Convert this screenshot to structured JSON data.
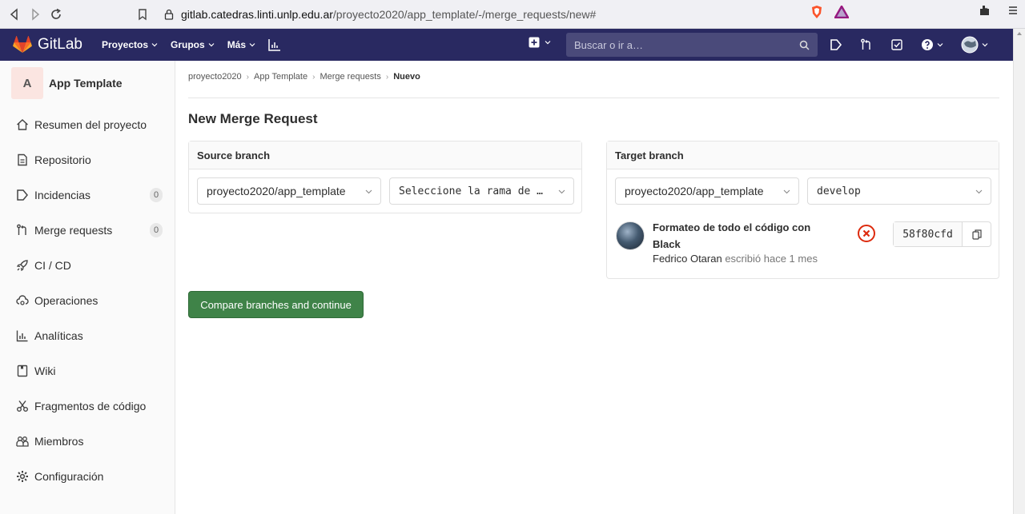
{
  "browser": {
    "url_host": "gitlab.catedras.linti.unlp.edu.ar",
    "url_path": "/proyecto2020/app_template/-/merge_requests/new#"
  },
  "navbar": {
    "brand": "GitLab",
    "menu": [
      "Proyectos",
      "Grupos",
      "Más"
    ],
    "search_placeholder": "Buscar o ir a…",
    "colors": {
      "bg": "#292961",
      "accent": "#fc6d26"
    }
  },
  "sidebar": {
    "project_avatar": "A",
    "project_name": "App Template",
    "items": [
      {
        "label": "Resumen del proyecto",
        "icon": "home-icon"
      },
      {
        "label": "Repositorio",
        "icon": "document-icon"
      },
      {
        "label": "Incidencias",
        "icon": "issues-icon",
        "badge": "0"
      },
      {
        "label": "Merge requests",
        "icon": "merge-request-icon",
        "badge": "0"
      },
      {
        "label": "CI / CD",
        "icon": "rocket-icon"
      },
      {
        "label": "Operaciones",
        "icon": "cloud-gear-icon"
      },
      {
        "label": "Analíticas",
        "icon": "chart-icon"
      },
      {
        "label": "Wiki",
        "icon": "book-icon"
      },
      {
        "label": "Fragmentos de código",
        "icon": "scissors-icon"
      },
      {
        "label": "Miembros",
        "icon": "users-icon"
      },
      {
        "label": "Configuración",
        "icon": "gear-icon"
      }
    ]
  },
  "breadcrumb": [
    "proyecto2020",
    "App Template",
    "Merge requests",
    "Nuevo"
  ],
  "page": {
    "title": "New Merge Request",
    "source": {
      "heading": "Source branch",
      "project": "proyecto2020/app_template",
      "branch_placeholder": "Seleccione la rama de …"
    },
    "target": {
      "heading": "Target branch",
      "project": "proyecto2020/app_template",
      "branch": "develop",
      "commit": {
        "title": "Formateo de todo el código con Black",
        "author": "Fedrico Otaran",
        "time_text": "escribió hace 1 mes",
        "sha": "58f80cfd"
      }
    },
    "compare_button": "Compare branches and continue",
    "colors": {
      "primary_green": "#3f8348",
      "failed_red": "#dd2b0e"
    }
  }
}
